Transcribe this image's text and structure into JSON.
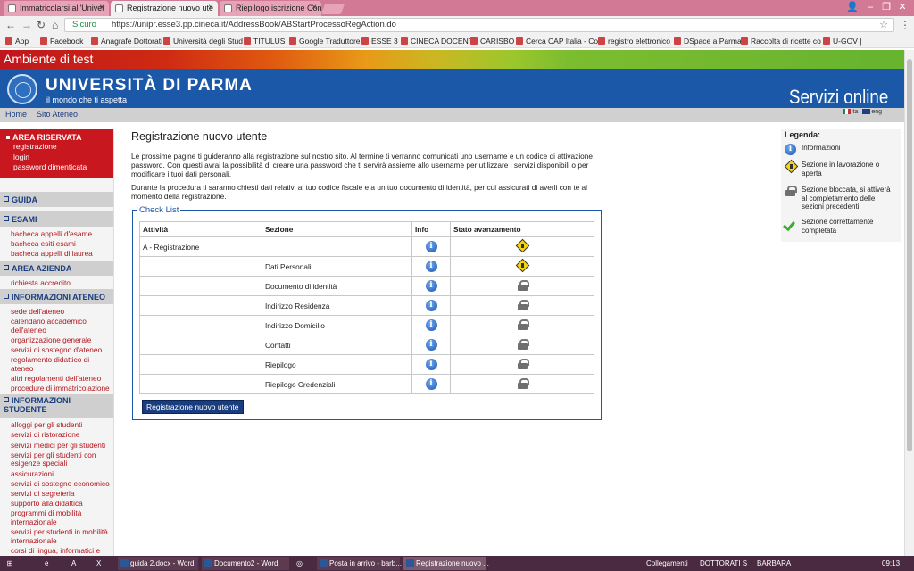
{
  "browser": {
    "tabs": [
      {
        "label": "Immatricolarsi all'Univer",
        "active": false
      },
      {
        "label": "Registrazione nuovo ute",
        "active": true
      },
      {
        "label": "Riepilogo iscrizione Con",
        "active": false
      }
    ],
    "address": {
      "secure_label": "Sicuro",
      "url": "https://unipr.esse3.pp.cineca.it/AddressBook/ABStartProcessoRegAction.do"
    },
    "bookmarks": [
      "App",
      "Facebook",
      "Anagrafe Dottorati",
      "Università degli Stud",
      "TITULUS",
      "Google Traduttore",
      "ESSE 3",
      "CINECA DOCENTI",
      "CARISBO",
      "Cerca CAP Italia - Co",
      "registro elettronico",
      "DSpace a Parma",
      "Raccolta di ricette co",
      "U-GOV |"
    ]
  },
  "site": {
    "env_label": "Ambiente di test",
    "uni_name": "UNIVERSITÀ DI PARMA",
    "tagline": "il mondo che ti aspetta",
    "services": "Servizi online",
    "lang_ita": "ita",
    "lang_eng": "eng",
    "topnav": [
      "Home",
      "Sito Ateneo"
    ]
  },
  "sidebar": {
    "reserved": {
      "title": "AREA RISERVATA",
      "links": [
        "registrazione",
        "login",
        "password dimenticata"
      ]
    },
    "sections": [
      {
        "title": "GUIDA",
        "items": []
      },
      {
        "title": "ESAMI",
        "items": [
          "bacheca appelli d'esame",
          "bacheca esiti esami",
          "bacheca appelli di laurea"
        ]
      },
      {
        "title": "AREA AZIENDA",
        "items": [
          "richiesta accredito"
        ]
      },
      {
        "title": "INFORMAZIONI ATENEO",
        "items": [
          "sede dell'ateneo",
          "calendario accademico dell'ateneo",
          "organizzazione generale",
          "servizi di sostegno d'ateneo",
          "regolamento didattico di ateneo",
          "altri regolamenti dell'ateneo",
          "procedure di immatricolazione"
        ]
      },
      {
        "title": "INFORMAZIONI STUDENTE",
        "items": [
          "alloggi per gli studenti",
          "servizi di ristorazione",
          "servizi medici per gli studenti",
          "servizi per gli studenti con esigenze speciali",
          "assicurazioni",
          "servizi di sostegno economico",
          "servizi di segreteria",
          "supporto alla didattica",
          "programmi di mobilità internazionale",
          "servizi per studenti in mobilità internazionale",
          "corsi di lingua, informatici e"
        ]
      }
    ]
  },
  "main": {
    "title": "Registrazione nuovo utente",
    "intro1": "Le prossime pagine ti guideranno alla registrazione sul nostro sito. Al termine ti verranno comunicati uno username e un codice di attivazione password. Con questi avrai la possibilità di creare una password che ti servirà assieme allo username per utilizzare i servizi disponibili o per modificare i tuoi dati personali.",
    "intro2": "Durante la procedura ti saranno chiesti dati relativi al tuo codice fiscale e a un tuo documento di identità, per cui assicurati di averli con te al momento della registrazione.",
    "checklist_title": "Check List",
    "columns": [
      "Attività",
      "Sezione",
      "Info",
      "Stato avanzamento"
    ],
    "rows": [
      {
        "activity": "A - Registrazione",
        "section": "",
        "status": "work"
      },
      {
        "activity": "",
        "section": "Dati Personali",
        "status": "work"
      },
      {
        "activity": "",
        "section": "Documento di identità",
        "status": "lock"
      },
      {
        "activity": "",
        "section": "Indirizzo Residenza",
        "status": "lock"
      },
      {
        "activity": "",
        "section": "Indirizzo Domicilio",
        "status": "lock"
      },
      {
        "activity": "",
        "section": "Contatti",
        "status": "lock"
      },
      {
        "activity": "",
        "section": "Riepilogo",
        "status": "lock"
      },
      {
        "activity": "",
        "section": "Riepilogo Credenziali",
        "status": "lock"
      }
    ],
    "button_label": "Registrazione nuovo utente"
  },
  "legend": {
    "title": "Legenda:",
    "items": [
      {
        "icon": "info-icon",
        "text": "Informazioni"
      },
      {
        "icon": "in-progress-icon",
        "text": "Sezione in lavorazione o aperta"
      },
      {
        "icon": "lock-icon",
        "text": "Sezione bloccata, si attiverà al completamento delle sezioni precedenti"
      },
      {
        "icon": "check-icon",
        "text": "Sezione correttamente completata"
      }
    ]
  },
  "taskbar": {
    "tasks": [
      "guida 2.docx - Word",
      "Documento2 - Word",
      "Posta in arrivo - barb...",
      "Registrazione nuovo ..."
    ],
    "tray": [
      "Collegamenti",
      "DOTTORATI S",
      "BARBARA"
    ],
    "clock": "09:13"
  }
}
